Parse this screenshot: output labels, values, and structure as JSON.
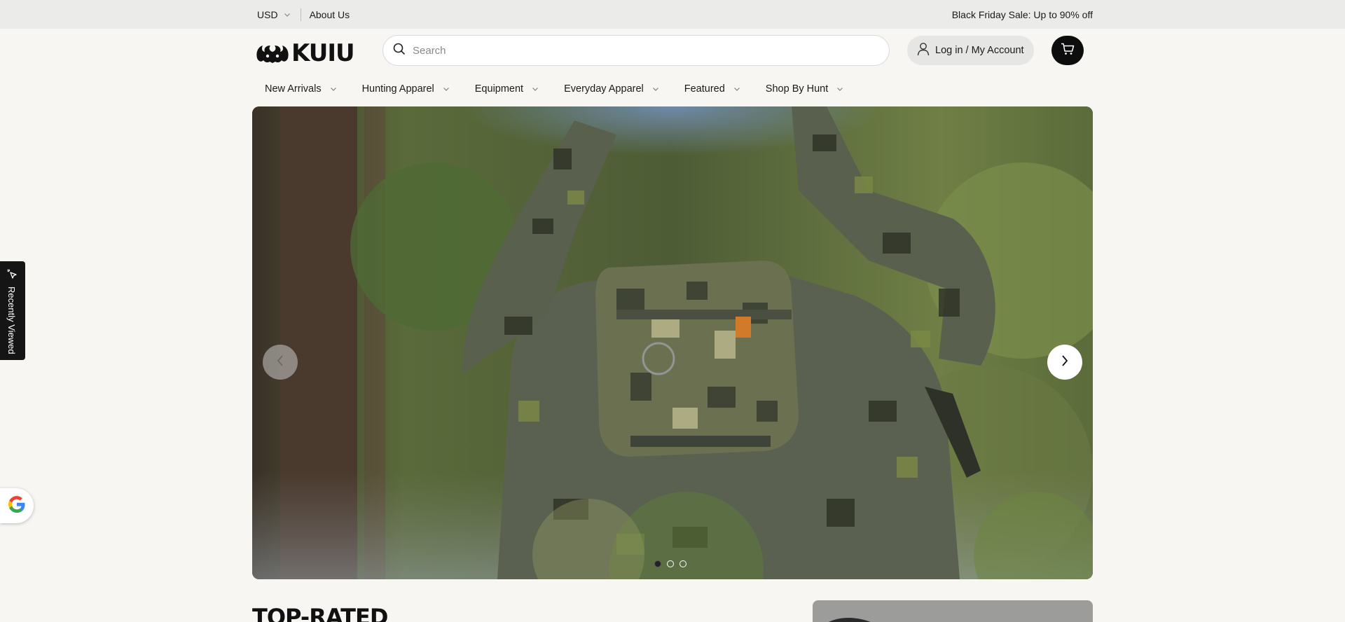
{
  "topbar": {
    "currency": "USD",
    "about": "About Us",
    "promo": "Black Friday Sale: Up to 90% off"
  },
  "header": {
    "logo_text": "KUIU",
    "search_placeholder": "Search",
    "account_label": "Log in / My Account"
  },
  "nav": {
    "items": [
      {
        "label": "New Arrivals"
      },
      {
        "label": "Hunting Apparel"
      },
      {
        "label": "Equipment"
      },
      {
        "label": "Everyday Apparel"
      },
      {
        "label": "Featured"
      },
      {
        "label": "Shop By Hunt"
      }
    ]
  },
  "hero": {
    "slide_count": 3,
    "active_slide": 1
  },
  "sidebar": {
    "recently_viewed": "Recently Viewed"
  },
  "section": {
    "title": "TOP-RATED"
  },
  "colors": {
    "accent": "#0d0d0d",
    "topbar_bg": "#ebebea",
    "page_bg": "#f7f6f3"
  }
}
